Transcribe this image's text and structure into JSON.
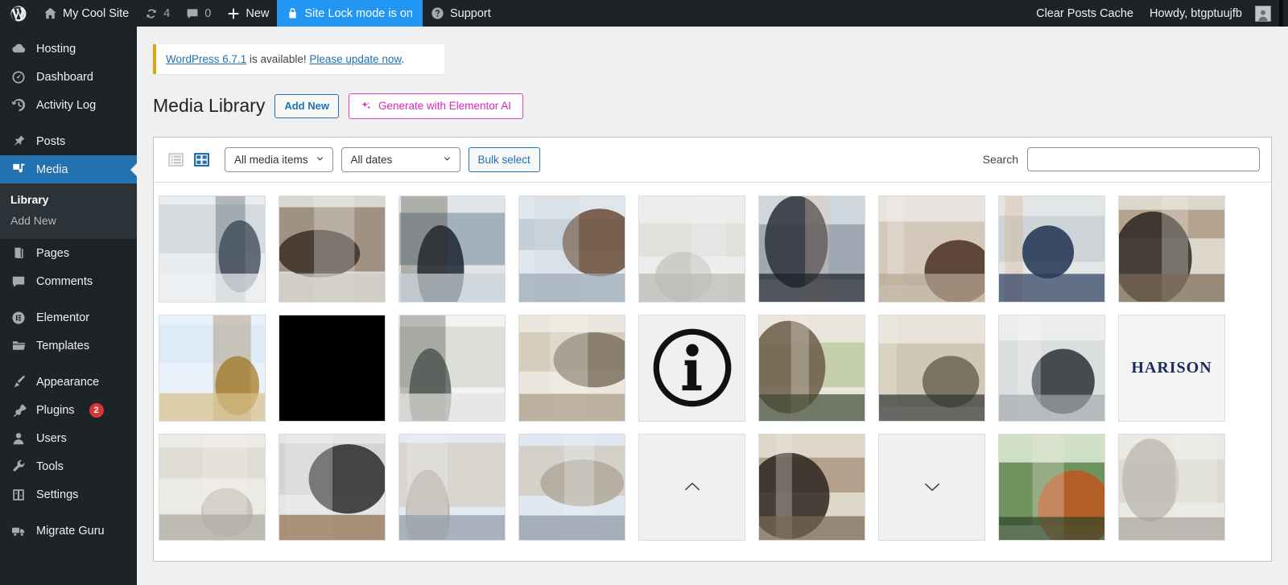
{
  "adminbar": {
    "logo_icon": "wordpress-logo-icon",
    "site_name": "My Cool Site",
    "site_icon": "home-icon",
    "updates_icon": "updates-icon",
    "updates_count": "4",
    "comments_icon": "comment-bubble-icon",
    "comments_count": "0",
    "new_icon": "plus-icon",
    "new_label": "New",
    "sitelock_icon": "lock-icon",
    "sitelock_label": "Site Lock mode is on",
    "sitelock_bg": "#2196f3",
    "support_icon": "question-mark-icon",
    "support_label": "Support",
    "clear_cache_label": "Clear Posts Cache",
    "howdy_label": "Howdy, btgptuujfb",
    "avatar_icon": "user-avatar-icon"
  },
  "sidebar": {
    "active_color": "#2271b1",
    "items": [
      {
        "label": "Hosting",
        "icon": "cloud-icon",
        "current": false
      },
      {
        "label": "Dashboard",
        "icon": "dashboard-gauge-icon",
        "current": false
      },
      {
        "label": "Activity Log",
        "icon": "clock-history-icon",
        "current": false
      },
      {
        "label": "Posts",
        "icon": "pin-icon",
        "current": false
      },
      {
        "label": "Media",
        "icon": "media-music-photo-icon",
        "current": true
      },
      {
        "label": "Pages",
        "icon": "pages-icon",
        "current": false
      },
      {
        "label": "Comments",
        "icon": "comment-bubble-icon",
        "current": false
      },
      {
        "label": "Elementor",
        "icon": "elementor-e-icon",
        "current": false
      },
      {
        "label": "Templates",
        "icon": "folder-icon",
        "current": false
      },
      {
        "label": "Appearance",
        "icon": "paintbrush-icon",
        "current": false
      },
      {
        "label": "Plugins",
        "icon": "plug-icon",
        "current": false,
        "badge": "2"
      },
      {
        "label": "Users",
        "icon": "user-icon",
        "current": false
      },
      {
        "label": "Tools",
        "icon": "wrench-icon",
        "current": false
      },
      {
        "label": "Settings",
        "icon": "settings-sliders-icon",
        "current": false
      },
      {
        "label": "Migrate Guru",
        "icon": "truck-icon",
        "current": false
      }
    ],
    "media_submenu": [
      {
        "label": "Library",
        "current": true
      },
      {
        "label": "Add New",
        "current": false
      }
    ]
  },
  "notice": {
    "link_version": "WordPress 6.7.1",
    "middle_text": " is available! ",
    "link_update": "Please update now",
    "end_text": ".",
    "accent": "#dba617"
  },
  "page": {
    "title": "Media Library",
    "add_new_label": "Add New",
    "elementor_ai_label": "Generate with Elementor AI",
    "elementor_ai_icon": "sparkles-icon",
    "elementor_ai_color": "#d926bb"
  },
  "toolbar": {
    "list_view_icon": "list-view-icon",
    "grid_view_icon": "grid-view-icon",
    "active_view": "grid",
    "media_filter": "All media items",
    "date_filter": "All dates",
    "bulk_select_label": "Bulk select",
    "chevron_icon": "chevron-down-icon",
    "search_label": "Search",
    "search_value": "",
    "search_placeholder": ""
  },
  "grid": {
    "items": [
      {
        "name": "man-in-suit-writing-at-desk",
        "kind": "photo",
        "p": [
          "#e8ecef",
          "#cfd6da",
          "#4a5664",
          "#2f3a47",
          "#eef2f4"
        ]
      },
      {
        "name": "smiling-woman-in-white-shirt",
        "kind": "photo",
        "p": [
          "#d9d7d2",
          "#8c7a68",
          "#3b2f28",
          "#f3f1ee",
          "#cfcac2"
        ]
      },
      {
        "name": "man-in-navy-cardigan-by-window",
        "kind": "photo",
        "p": [
          "#dfe4e7",
          "#8fa0ad",
          "#1b2432",
          "#40321f",
          "#c9d2d8"
        ]
      },
      {
        "name": "woman-with-arms-crossed",
        "kind": "photo",
        "p": [
          "#dfe6ec",
          "#b9c6d2",
          "#6a4a36",
          "#cfd9e2",
          "#9aa8b5"
        ]
      },
      {
        "name": "white-corridor-staircase",
        "kind": "photo",
        "p": [
          "#ececea",
          "#dcdcd8",
          "#c8c8c4",
          "#f3f3f1",
          "#b9b9b5"
        ]
      },
      {
        "name": "man-with-glasses-portrait",
        "kind": "photo",
        "p": [
          "#cfd6dc",
          "#8d9aa6",
          "#2b3038",
          "#e3c9b4",
          "#1b2026"
        ]
      },
      {
        "name": "smiling-woman-in-white-blazer",
        "kind": "photo",
        "p": [
          "#e7e4df",
          "#cdbfae",
          "#4a2f22",
          "#f5f2ee",
          "#b8a894"
        ]
      },
      {
        "name": "bearded-man-on-phone",
        "kind": "photo",
        "p": [
          "#e3e6e7",
          "#c6ccd0",
          "#1f3150",
          "#d9a882",
          "#2a3c5e"
        ]
      },
      {
        "name": "handshake-over-desk",
        "kind": "photo",
        "p": [
          "#ded7cb",
          "#a6917a",
          "#2b2520",
          "#f0ece6",
          "#7b6a55"
        ]
      },
      {
        "name": "golden-angel-statue",
        "kind": "photo",
        "p": [
          "#e8f0fa",
          "#dbe8f7",
          "#b08a3c",
          "#8c6a28",
          "#d8c188"
        ]
      },
      {
        "name": "solid-black-image",
        "kind": "solid",
        "color": "#000000"
      },
      {
        "name": "two-women-in-office-meeting",
        "kind": "photo",
        "p": [
          "#f2f2f0",
          "#d5d6d2",
          "#5e6460",
          "#2f3430",
          "#e2e3df"
        ]
      },
      {
        "name": "team-high-five-at-table",
        "kind": "photo",
        "p": [
          "#ece7de",
          "#cfc4b2",
          "#7e7160",
          "#f4f1ea",
          "#a89a85"
        ]
      },
      {
        "name": "info-icon-placeholder",
        "kind": "icon",
        "icon": "info-circle-icon"
      },
      {
        "name": "team-presentation-meeting",
        "kind": "photo",
        "p": [
          "#eae5dc",
          "#b8c79a",
          "#6b5c48",
          "#f2efe8",
          "#3f4a33"
        ]
      },
      {
        "name": "colleagues-high-five-celebrating",
        "kind": "photo",
        "p": [
          "#e9e4da",
          "#c8bda8",
          "#6f6454",
          "#f3f0e9",
          "#2c3330"
        ]
      },
      {
        "name": "woman-at-desk-with-laptop",
        "kind": "photo",
        "p": [
          "#eceeee",
          "#d5d8d9",
          "#2d3136",
          "#f5f6f6",
          "#9fa5a8"
        ]
      },
      {
        "name": "harison-logo",
        "kind": "logo",
        "text": "HARISON",
        "color": "#1b2a5e"
      },
      {
        "name": "white-columns-colonnade",
        "kind": "photo",
        "p": [
          "#eceae5",
          "#dad7cf",
          "#c2beb4",
          "#f4f2ee",
          "#a9a69c"
        ]
      },
      {
        "name": "woman-celebrating-at-laptop",
        "kind": "photo",
        "p": [
          "#e4e5e5",
          "#cdcecd",
          "#2a2a2c",
          "#f3f3f3",
          "#8e6b4a"
        ]
      },
      {
        "name": "modern-office-building",
        "kind": "photo",
        "p": [
          "#e3eaf2",
          "#d3cdc0",
          "#b5ada0",
          "#f0f3f7",
          "#8e9aa6"
        ]
      },
      {
        "name": "office-building-facade",
        "kind": "photo",
        "p": [
          "#dfe8f1",
          "#cfc9bc",
          "#b0a89a",
          "#eef2f6",
          "#8b97a3"
        ]
      },
      {
        "name": "placeholder-chevron-up",
        "kind": "icon",
        "icon": "chevron-up-icon"
      },
      {
        "name": "handshake-with-notebook",
        "kind": "photo",
        "p": [
          "#ded6c9",
          "#a58f76",
          "#2d261f",
          "#efeae2",
          "#796751"
        ]
      },
      {
        "name": "placeholder-chevron-down",
        "kind": "icon",
        "icon": "chevron-down-icon"
      },
      {
        "name": "two-colleagues-on-couch-with-laptop",
        "kind": "photo",
        "p": [
          "#cfe0c4",
          "#4f7a3c",
          "#c0551f",
          "#ede8df",
          "#2f4428"
        ]
      },
      {
        "name": "white-columns-hallway",
        "kind": "photo",
        "p": [
          "#ebe9e4",
          "#d8d5cd",
          "#c0bcb2",
          "#f3f1ed",
          "#a7a39a"
        ]
      }
    ]
  }
}
